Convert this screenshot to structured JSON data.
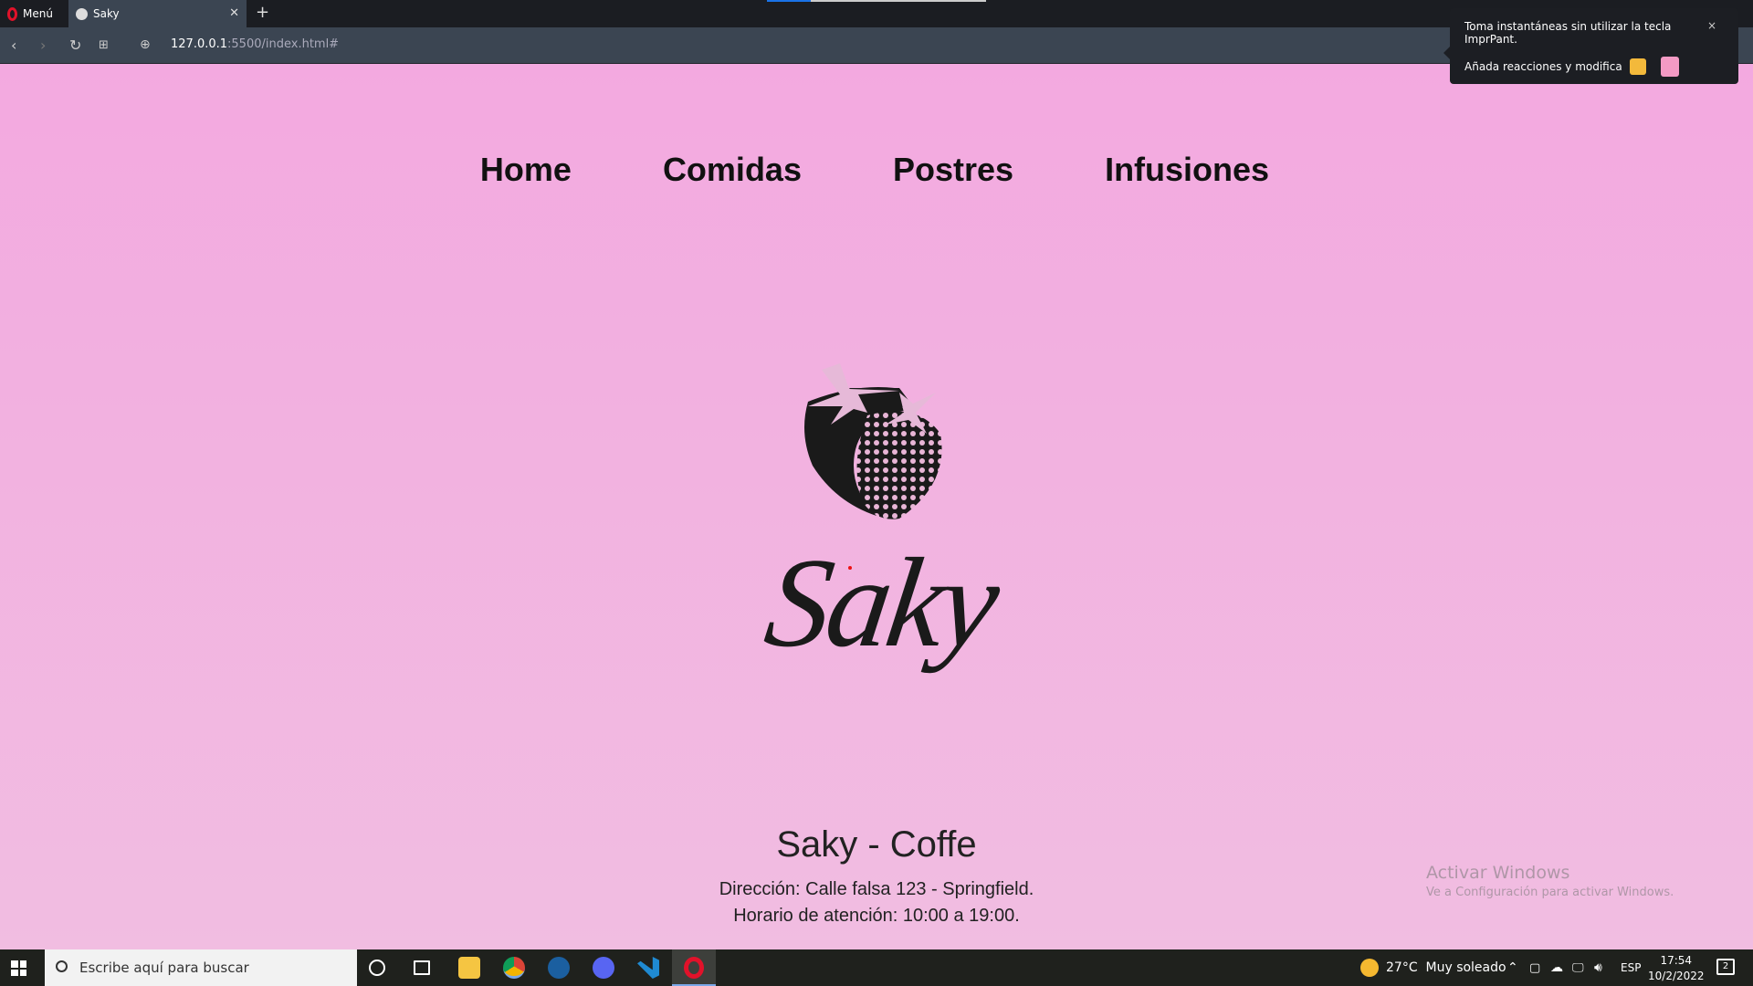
{
  "browser": {
    "menu_label": "Menú",
    "tab_title": "Saky",
    "url_host": "127.0.0.1",
    "url_rest": ":5500/index.html#"
  },
  "toast": {
    "line1": "Toma instantáneas sin utilizar la tecla ImprPant.",
    "line2": "Añada reacciones y modifica",
    "close": "×"
  },
  "nav": {
    "items": [
      "Home",
      "Comidas",
      "Postres",
      "Infusiones"
    ]
  },
  "logo": {
    "text": "Saky"
  },
  "info": {
    "title": "Saky - Coffe",
    "address": "Dirección: Calle falsa 123 - Springfield.",
    "hours": "Horario de atención: 10:00 a 19:00."
  },
  "watermark": {
    "title": "Activar Windows",
    "subtitle": "Ve a Configuración para activar Windows."
  },
  "taskbar": {
    "search_placeholder": "Escribe aquí para buscar",
    "weather": "27°C",
    "weather_desc": "Muy soleado",
    "lang": "ESP",
    "time": "17:54",
    "date": "10/2/2022",
    "notifications": "2"
  }
}
